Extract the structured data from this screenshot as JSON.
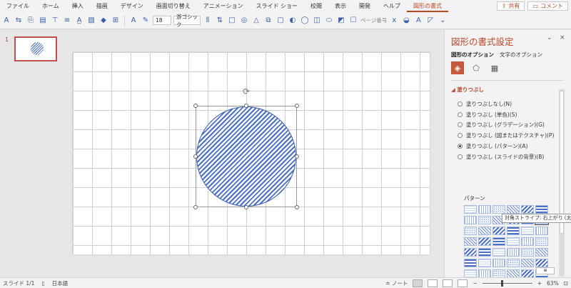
{
  "menu": {
    "tabs": [
      "ファイル",
      "ホーム",
      "挿入",
      "描画",
      "デザイン",
      "画面切り替え",
      "アニメーション",
      "スライド ショー",
      "校閲",
      "表示",
      "開発",
      "ヘルプ",
      "図形の書式"
    ],
    "active_tab": "図形の書式",
    "share_label": "共有",
    "comment_label": "コメント"
  },
  "ribbon": {
    "font_size": "18",
    "font_name": "游ゴシック",
    "page_number_label": "ページ番号"
  },
  "thumbnails": {
    "slide_number": "1"
  },
  "tooltip": "対角ストライプ: 右上がり (太)",
  "format_pane": {
    "title": "図形の書式設定",
    "tab_shape": "図形のオプション",
    "tab_text": "文字のオプション",
    "section_fill": "塗りつぶし",
    "fill_options": [
      "塗りつぶしなし(N)",
      "塗りつぶし (単色)(S)",
      "塗りつぶし (グラデーション)(G)",
      "塗りつぶし (図またはテクスチャ)(P)",
      "塗りつぶし (パターン)(A)",
      "塗りつぶし (スライドの背景)(B)"
    ],
    "selected_fill_index": 4,
    "pattern_label": "パターン",
    "accent_color": "#b7472a",
    "pattern_color": "#4a6fc7"
  },
  "status": {
    "slide_indicator": "スライド 1/1",
    "language": "日本語",
    "notes_label": "ノート",
    "zoom": "63%"
  }
}
